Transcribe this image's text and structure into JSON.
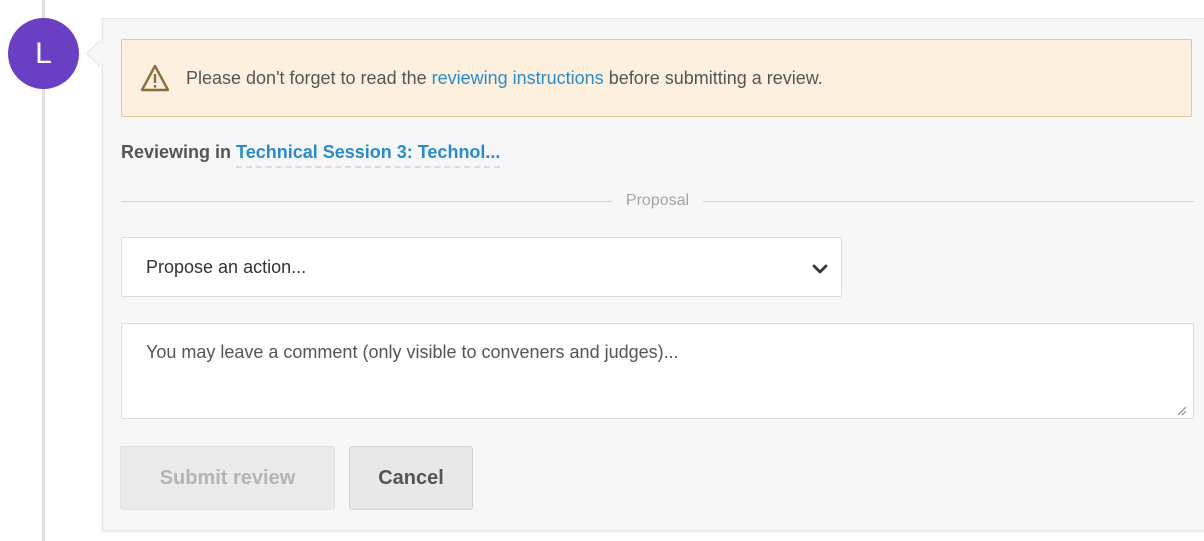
{
  "avatar": {
    "initial": "L",
    "color": "#6a3fc4"
  },
  "warning": {
    "text_before": "Please don't forget to read the ",
    "link_text": "reviewing instructions",
    "text_after": " before submitting a review.",
    "icon": "warning-triangle-icon"
  },
  "reviewing": {
    "prefix": "Reviewing in ",
    "session": "Technical Session 3: Technol..."
  },
  "proposal": {
    "label": "Proposal"
  },
  "action_select": {
    "selected": "Propose an action...",
    "icon": "chevron-down-icon"
  },
  "comment": {
    "placeholder": "You may leave a comment (only visible to conveners and judges)..."
  },
  "buttons": {
    "submit_label": "Submit review",
    "cancel_label": "Cancel"
  },
  "colors": {
    "accent_link": "#2b8bc9",
    "warning_bg": "#fdf0df",
    "warning_border": "#e8c59a"
  }
}
